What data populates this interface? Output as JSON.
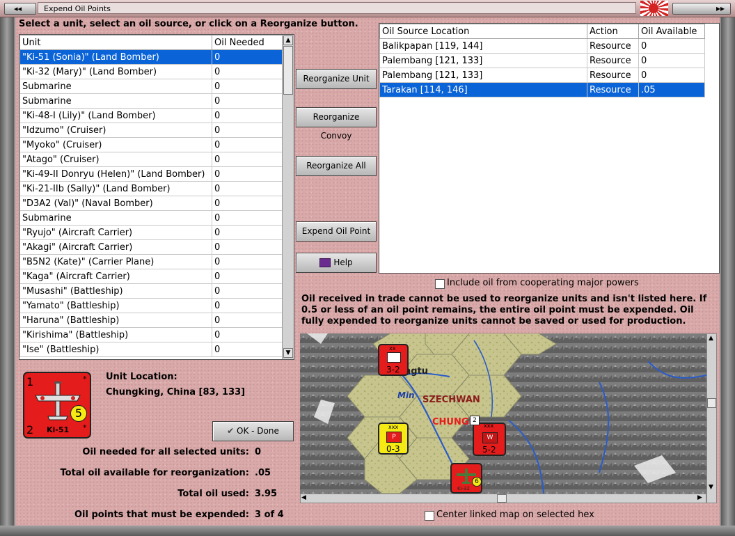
{
  "window": {
    "title": "Expend Oil Points"
  },
  "instructions": "Select a unit, select an oil source, or click on a Reorganize button.",
  "units_table": {
    "columns": [
      "Unit",
      "Oil Needed"
    ],
    "rows": [
      [
        "\"Ki-51 (Sonia)\" (Land Bomber)",
        "0"
      ],
      [
        "\"Ki-32 (Mary)\" (Land Bomber)",
        "0"
      ],
      [
        "Submarine",
        "0"
      ],
      [
        "Submarine",
        "0"
      ],
      [
        "\"Ki-48-I (Lily)\" (Land Bomber)",
        "0"
      ],
      [
        "\"Idzumo\" (Cruiser)",
        "0"
      ],
      [
        "\"Myoko\" (Cruiser)",
        "0"
      ],
      [
        "\"Atago\" (Cruiser)",
        "0"
      ],
      [
        "\"Ki-49-II Donryu (Helen)\" (Land Bomber)",
        "0"
      ],
      [
        "\"Ki-21-IIb (Sally)\" (Land Bomber)",
        "0"
      ],
      [
        "\"D3A2 (Val)\" (Naval Bomber)",
        "0"
      ],
      [
        "Submarine",
        "0"
      ],
      [
        "\"Ryujo\" (Aircraft Carrier)",
        "0"
      ],
      [
        "\"Akagi\" (Aircraft Carrier)",
        "0"
      ],
      [
        "\"B5N2 (Kate)\" (Carrier Plane)",
        "0"
      ],
      [
        "\"Kaga\" (Aircraft Carrier)",
        "0"
      ],
      [
        "\"Musashi\" (Battleship)",
        "0"
      ],
      [
        "\"Yamato\" (Battleship)",
        "0"
      ],
      [
        "\"Haruna\" (Battleship)",
        "0"
      ],
      [
        "\"Kirishima\" (Battleship)",
        "0"
      ],
      [
        "\"Ise\" (Battleship)",
        "0"
      ]
    ],
    "selected_index": 0
  },
  "buttons": {
    "reorganize_unit": "Reorganize Unit",
    "reorganize_convoy": "Reorganize Convoy",
    "reorganize_all": "Reorganize All",
    "expend_oil_point": "Expend Oil Point",
    "help": "Help",
    "ok_done": "OK - Done"
  },
  "oil_sources_table": {
    "columns": [
      "Oil Source Location",
      "Action",
      "Oil Available"
    ],
    "rows": [
      [
        "Balikpapan [119, 144]",
        "Resource",
        "0"
      ],
      [
        "Palembang [121, 133]",
        "Resource",
        "0"
      ],
      [
        "Palembang [121, 133]",
        "Resource",
        "0"
      ],
      [
        "Tarakan [114, 146]",
        "Resource",
        ".05"
      ]
    ],
    "selected_index": 3
  },
  "include_cooperating": {
    "label": "Include oil from cooperating major powers",
    "checked": false
  },
  "notice": "Oil received in trade cannot be used to reorganize units and isn't listed here.  If 0.5 or less of an oil point remains, the entire oil point must be expended.   Oil fully expended to reorganize units cannot be saved or used for production.",
  "unit_counter": {
    "top_left": "1",
    "bottom_left": "2",
    "strength": "5",
    "name": "Ki-51",
    "star_top": "*",
    "star_bottom": "*"
  },
  "unit_location": {
    "label": "Unit Location:",
    "value": "Chungking, China [83, 133]"
  },
  "totals": {
    "oil_needed_label": "Oil needed for all selected units:",
    "oil_needed_value": "0",
    "total_available_label": "Total oil available for reorganization:",
    "total_available_value": ".05",
    "total_used_label": "Total oil used:",
    "total_used_value": "3.95",
    "must_expend_label": "Oil points that must be expended:",
    "must_expend_value": "3 of 4"
  },
  "map": {
    "region_label": "SZECHWAN",
    "city_label": "CHUNGKI",
    "city_label_2": "ngtu",
    "river_label": "Min",
    "counters": [
      {
        "label": "3-2",
        "top": "xx"
      },
      {
        "label": "0-3",
        "top": "xxx",
        "letter": "P"
      },
      {
        "label": "5-2",
        "top": "xxx",
        "letter": "W",
        "badge": "2"
      },
      {
        "label": "6",
        "name": "Ki-32"
      }
    ]
  },
  "center_linked_map": {
    "label": "Center linked map on selected hex",
    "checked": false
  },
  "colors": {
    "selection": "#0a64d8",
    "background": "#d9a8a8",
    "counter_red": "#e41c1c",
    "counter_yellow": "#f5ea14"
  }
}
